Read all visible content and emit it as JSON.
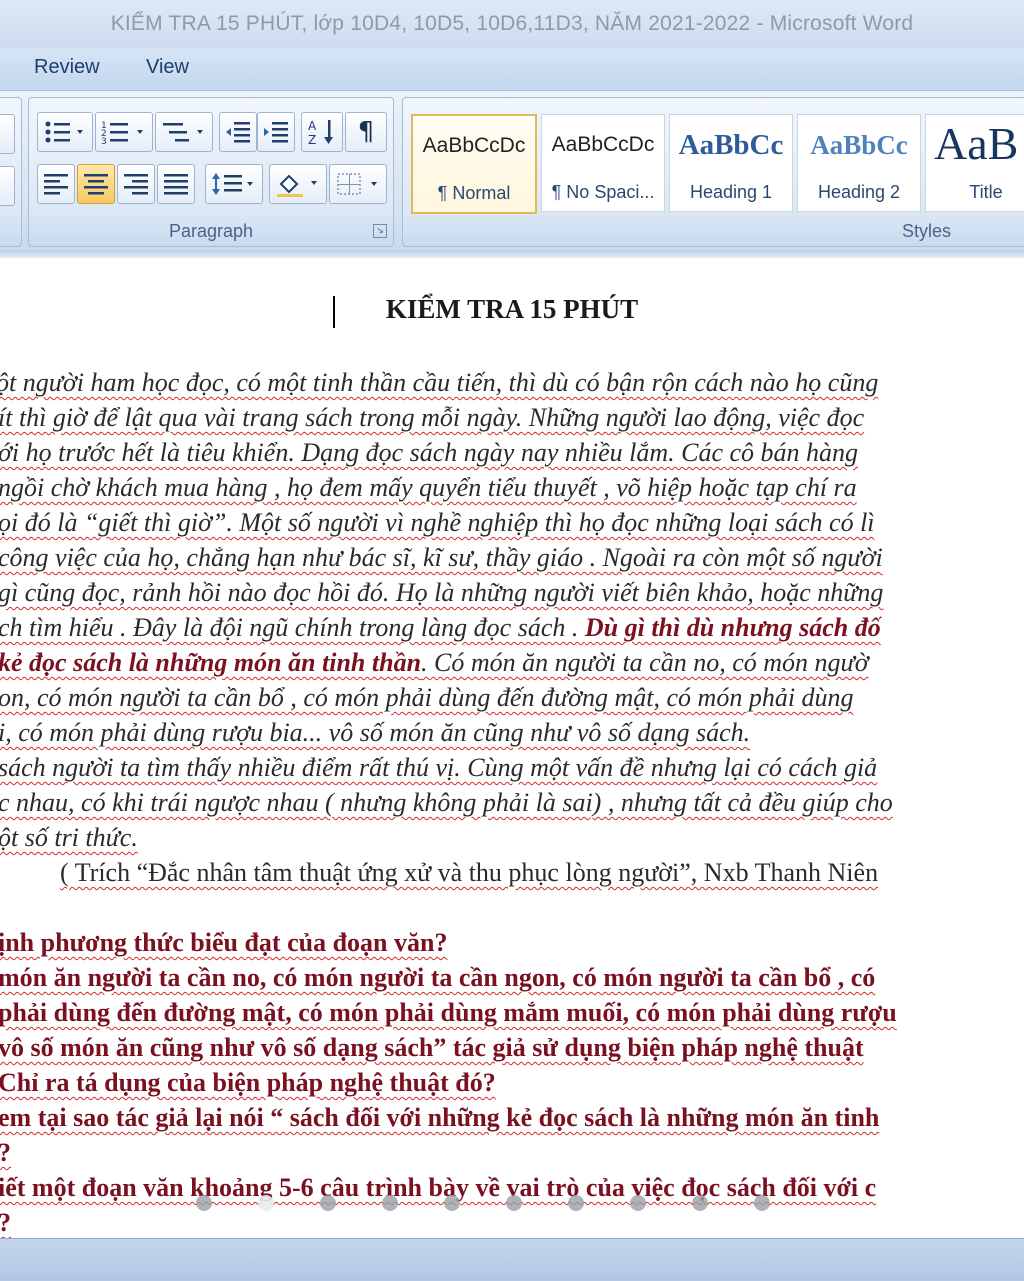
{
  "window": {
    "title": "KIỂM TRA 15 PHÚT, lớp 10D4, 10D5, 10D6,11D3, NĂM 2021-2022 - Microsoft Word"
  },
  "ribbon": {
    "tabs": [
      "Review",
      "View"
    ],
    "paragraph_group_label": "Paragraph",
    "styles_group_label": "Styles",
    "styles": [
      {
        "sample": "AaBbCcDc",
        "name": "¶ Normal"
      },
      {
        "sample": "AaBbCcDc",
        "name": "¶ No Spaci..."
      },
      {
        "sample": "AaBbCc",
        "name": "Heading 1"
      },
      {
        "sample": "AaBbCc",
        "name": "Heading 2"
      },
      {
        "sample": "AaB",
        "name": "Title"
      }
    ],
    "pilcrow": "¶"
  },
  "document": {
    "title": "KIỂM TRA 15 PHÚT",
    "passage": [
      "ột người ham học đọc, có một tinh thần cầu tiến, thì dù có bận rộn cách nào họ cũng",
      "ít thì giờ để lật qua vài trang sách trong mỗi ngày. Những người lao động, việc đọc",
      "ới họ trước hết là tiêu khiển. Dạng đọc sách ngày nay nhiều lắm. Các cô bán hàng",
      "ngồi chờ khách mua hàng , họ đem mấy quyển tiểu thuyết , võ hiệp hoặc tạp chí ra",
      "ọi đó là “giết thì giờ”. Một số người vì nghề nghiệp  thì họ đọc những loại sách có lì",
      "công việc của họ, chẳng hạn như bác sĩ, kĩ sư, thầy giáo . Ngoài ra còn một số người",
      "gì cũng đọc, rảnh hồi nào đọc hồi đó. Họ là  những người viết biên khảo, hoặc những",
      "ch tìm hiểu . Đây là đội ngũ chính trong làng đọc sách . "
    ],
    "passage_bold_1": "Dù gì thì dù nhưng  sách đố",
    "passage_bold_2": " kẻ đọc sách là những  món ăn tinh thần",
    "passage_after_bold": ". Có món ăn người ta cần no, có món ngườ",
    "passage_tail": [
      "on, có món người ta cần bổ , có món phải dùng đến đường  mật, có món phải dùng",
      "i, có món phải dùng rượu bia... vô số món ăn cũng như vô số dạng sách.",
      " sách người ta tìm thấy nhiều điểm rất thú vị. Cùng một vấn đề nhưng lại có cách giả",
      "c nhau, có khi trái ngược nhau  ( nhưng không phải là sai) , nhưng tất cả đều giúp cho",
      "ột số tri thức."
    ],
    "citation": "( Trích  “Đắc nhân tâm thuật ứng xử và thu phục lòng người”, Nxb Thanh Niên",
    "questions": [
      "ịnh phương  thức biểu đạt của đoạn văn?",
      "món ăn người ta cần no, có món người  ta cần ngon, có món người ta cần bổ , có",
      "phải dùng đến đường  mật, có món phải dùng mắm muối, có món phải dùng rượu",
      " vô số món ăn cũng như vô số dạng sách” tác giả sử dụng biện pháp nghệ thuật",
      "Chỉ ra tá dụng của biện pháp nghệ thuật đó?",
      "em tại sao tác giả lại nói “ sách đối với những  kẻ đọc sách là những  món ăn tinh",
      "?",
      "iết một đoạn văn khoảng 5-6 câu trình bày về vai trò của việc đọc sách đối với c",
      "?"
    ]
  },
  "colors": {
    "question_text": "#7a1020",
    "spell_underline": "#d42a2a",
    "selected_style": "#e3b75a"
  }
}
